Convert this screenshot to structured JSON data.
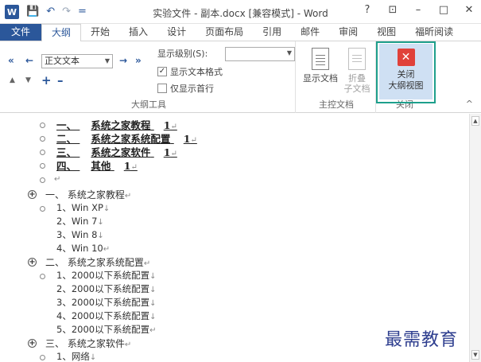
{
  "window": {
    "title": "实验文件 - 副本.docx [兼容模式] - Word",
    "app_icon_letter": "W",
    "quick_access": [
      "💾",
      "↶",
      "↷",
      "="
    ],
    "controls": [
      "?",
      "⊡",
      "–",
      "□",
      "✕"
    ]
  },
  "tabs": [
    "文件",
    "大纲",
    "开始",
    "插入",
    "设计",
    "页面布局",
    "引用",
    "邮件",
    "审阅",
    "视图",
    "福昕阅读"
  ],
  "active_tab": "大纲",
  "ribbon": {
    "outline_tools": {
      "level_value": "正文文本",
      "show_level_label": "显示级别(S):",
      "show_level_value": "",
      "show_text_format_label": "显示文本格式",
      "show_text_format_checked": true,
      "show_first_line_label": "仅显示首行",
      "show_first_line_checked": false,
      "group_label": "大纲工具",
      "arrows": [
        "«",
        "←",
        "→",
        "»",
        "▲",
        "▼",
        "+",
        "–"
      ]
    },
    "master_doc": {
      "show_doc_label": "显示文档",
      "collapse_label_1": "折叠",
      "collapse_label_2": "子文档",
      "group_label": "主控文档"
    },
    "close": {
      "label_1": "关闭",
      "label_2": "大纲视图",
      "icon": "✕",
      "group_label": "关闭"
    },
    "collapse_ribbon": "^"
  },
  "document": {
    "toc": [
      {
        "num": "一、",
        "text": "系统之家教程",
        "page": "1"
      },
      {
        "num": "二、",
        "text": "系统之家系统配置",
        "page": "1"
      },
      {
        "num": "三、",
        "text": "系统之家软件",
        "page": "1"
      },
      {
        "num": "四、",
        "text": "其他",
        "page": "1"
      }
    ],
    "paragraph_mark": "↵",
    "line_break_mark": "↓",
    "sections": [
      {
        "heading": "一、 系统之家教程",
        "items": [
          "1、Win XP",
          "2、Win 7",
          "3、Win 8",
          "4、Win 10"
        ]
      },
      {
        "heading": "二、 系统之家系统配置",
        "items": [
          "1、2000以下系统配置",
          "2、2000以下系统配置",
          "3、2000以下系统配置",
          "4、2000以下系统配置",
          "5、2000以下系统配置"
        ]
      },
      {
        "heading": "三、 系统之家软件",
        "items": [
          "1、网络"
        ]
      }
    ]
  },
  "watermark": "最需教育",
  "colors": {
    "word_blue": "#2b579a",
    "close_highlight": "#1e9f8c",
    "close_button_bg": "#cfe0f3",
    "close_icon_red": "#e0413a",
    "watermark": "#2e3e8f"
  }
}
